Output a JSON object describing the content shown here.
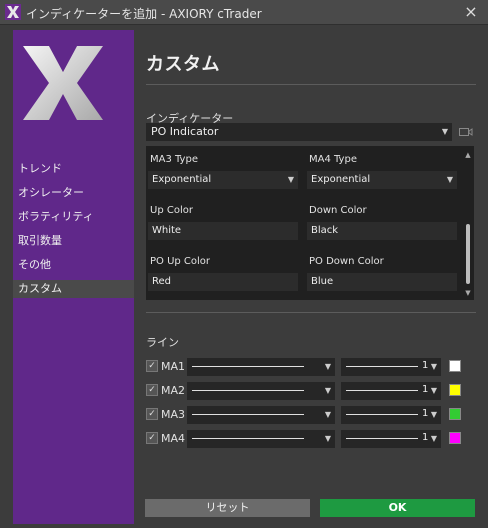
{
  "window": {
    "title": "インディケーターを追加 - AXIORY cTrader",
    "close_icon": "×"
  },
  "sidebar": {
    "items": [
      {
        "label": "トレンド"
      },
      {
        "label": "オシレーター"
      },
      {
        "label": "ボラティリティ"
      },
      {
        "label": "取引数量"
      },
      {
        "label": "その他"
      },
      {
        "label": "カスタム",
        "selected": true
      }
    ]
  },
  "main": {
    "title": "カスタム",
    "indicator_label": "インディケーター",
    "indicator_value": "PO Indicator",
    "params": {
      "ma3_type_label": "MA3 Type",
      "ma3_type_value": "Exponential",
      "ma4_type_label": "MA4 Type",
      "ma4_type_value": "Exponential",
      "up_color_label": "Up Color",
      "up_color_value": "White",
      "down_color_label": "Down Color",
      "down_color_value": "Black",
      "po_up_color_label": "PO Up Color",
      "po_up_color_value": "Red",
      "po_down_color_label": "PO Down Color",
      "po_down_color_value": "Blue"
    },
    "lines_label": "ライン",
    "lines": [
      {
        "name": "MA1",
        "checked": true,
        "width": "1",
        "color": "#ffffff"
      },
      {
        "name": "MA2",
        "checked": true,
        "width": "1",
        "color": "#ffff00"
      },
      {
        "name": "MA3",
        "checked": true,
        "width": "1",
        "color": "#33cc33"
      },
      {
        "name": "MA4",
        "checked": true,
        "width": "1",
        "color": "#ff00ff"
      }
    ]
  },
  "buttons": {
    "reset": "リセット",
    "ok": "OK"
  },
  "colors": {
    "sidebar": "#60288a",
    "ok": "#1e9a41",
    "background": "#3c3c3c"
  }
}
